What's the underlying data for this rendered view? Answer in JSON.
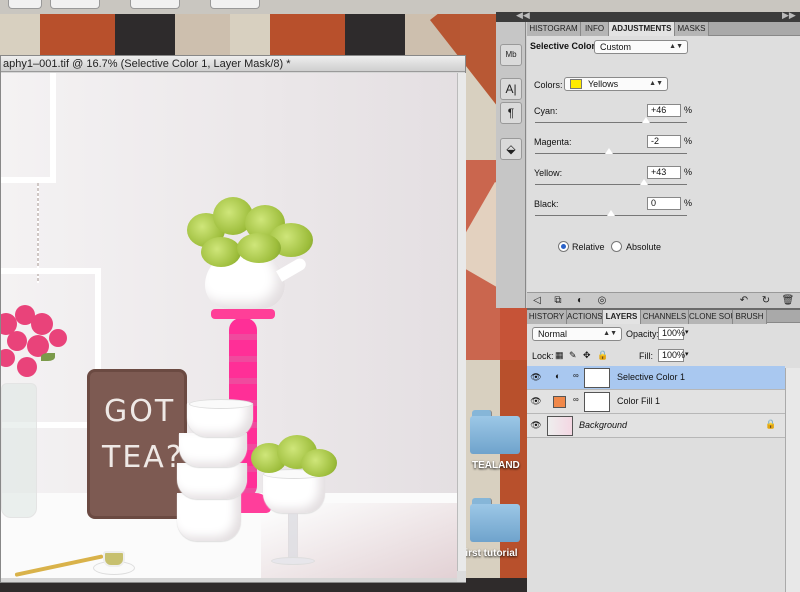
{
  "document": {
    "title": "aphy1–001.tif @ 16.7% (Selective Color 1, Layer Mask/8) *",
    "chalkboard_line1": "GOT",
    "chalkboard_line2": "TEA?"
  },
  "desktop": {
    "folders": [
      {
        "label": "TEALAND"
      },
      {
        "label": "first tutorial"
      }
    ]
  },
  "adjustments_panel": {
    "tabs": [
      "HISTOGRAM",
      "INFO",
      "ADJUSTMENTS",
      "MASKS"
    ],
    "active_tab": "ADJUSTMENTS",
    "title": "Selective Color",
    "preset": "Custom",
    "colors_label": "Colors:",
    "colors_value": "Yellows",
    "colors_swatch": "#ffea00",
    "sliders": [
      {
        "label": "Cyan:",
        "value": "+46",
        "unit": "%",
        "pos": 0.73
      },
      {
        "label": "Magenta:",
        "value": "-2",
        "unit": "%",
        "pos": 0.49
      },
      {
        "label": "Yellow:",
        "value": "+43",
        "unit": "%",
        "pos": 0.715
      },
      {
        "label": "Black:",
        "value": "0",
        "unit": "%",
        "pos": 0.5
      }
    ],
    "method_options": [
      "Relative",
      "Absolute"
    ],
    "method_selected": "Relative"
  },
  "layers_panel": {
    "tabs": [
      "HISTORY",
      "ACTIONS",
      "LAYERS",
      "CHANNELS",
      "CLONE SOU",
      "BRUSH"
    ],
    "active_tab": "LAYERS",
    "blend_mode": "Normal",
    "opacity_label": "Opacity:",
    "opacity_value": "100%",
    "lock_label": "Lock:",
    "fill_label": "Fill:",
    "fill_value": "100%",
    "layers": [
      {
        "name": "Selective Color 1",
        "selected": true,
        "italic": false
      },
      {
        "name": "Color Fill 1",
        "selected": false,
        "italic": false,
        "fill_color": "#f0884a"
      },
      {
        "name": "Background",
        "selected": false,
        "italic": true
      }
    ]
  },
  "colors": {
    "selection": "#a9c8f0",
    "accent_pink": "#ff2f97"
  }
}
